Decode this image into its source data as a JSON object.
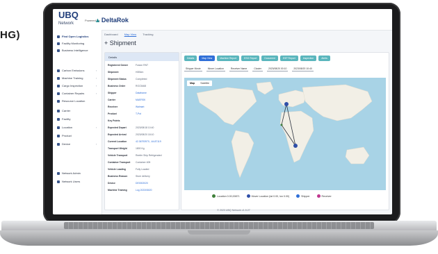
{
  "page_edge_text": "HG)",
  "app": {
    "logo_main": "UBQ",
    "logo_sub": "Network",
    "powered_by": "Powered By",
    "partner": "DeltaRok"
  },
  "sidebar": {
    "items": [
      {
        "label": "Find Open Logistics"
      },
      {
        "label": "Facility Monitoring"
      },
      {
        "label": "Business Intelligence"
      },
      {
        "label": "Carbon Emissions"
      },
      {
        "label": "Machine Training"
      },
      {
        "label": "Cargo Inspection"
      },
      {
        "label": "Container Repairs"
      },
      {
        "label": "Resource Location"
      },
      {
        "label": "Carrier"
      },
      {
        "label": "Facility"
      },
      {
        "label": "Location"
      },
      {
        "label": "Product"
      },
      {
        "label": "Device"
      },
      {
        "label": "Network Admin"
      },
      {
        "label": "Network Users"
      }
    ]
  },
  "breadcrumb": [
    "Dashboard",
    "Map View",
    "Tracking"
  ],
  "page_title": "Shipment",
  "details": {
    "header": "Details",
    "rows": [
      {
        "label": "Registered Owner",
        "value": "Fusion RNT"
      },
      {
        "label": "Shipment",
        "value": "H0B4m"
      },
      {
        "label": "Shipment Status",
        "value": "Completed"
      },
      {
        "label": "Business Order",
        "value": "ROC5468"
      },
      {
        "label": "Shipper",
        "value": "Dataframe"
      },
      {
        "label": "Carrier",
        "value": "MAERSK"
      },
      {
        "label": "Receiver",
        "value": "Walmart"
      },
      {
        "label": "Product",
        "value": "T-Pot"
      },
      {
        "label": "Key Points",
        "value": ""
      },
      {
        "label": "Expected Depart",
        "value": "2023/08/18 10:40"
      },
      {
        "label": "Expected Arrival",
        "value": "2023/08/20 18:10"
      },
      {
        "label": "Current Location",
        "value": "42.36793970, -64.87119"
      },
      {
        "label": "Transport Weight",
        "value": "1800 Kg"
      },
      {
        "label": "Vehicle Transport",
        "value": "Reefer Ship Refrigerated"
      },
      {
        "label": "Container Transport",
        "value": "Container 40ft"
      },
      {
        "label": "Vehicle Loading",
        "value": "Fully Loaded"
      },
      {
        "label": "Business Reason",
        "value": "Store delivery"
      },
      {
        "label": "Device",
        "value": "DE0002020"
      },
      {
        "label": "Machine Training",
        "value": "Log 2023/08/20"
      }
    ]
  },
  "map_panel": {
    "tabs": [
      "Details",
      "Map View",
      "Machine Report",
      "ESG Report",
      "Document",
      "ESP Report",
      "Inspection",
      "Alerts"
    ],
    "active_tab": "Map View",
    "filters": [
      "Shipper Movie",
      "Mover Location",
      "Receiver Name",
      "Cluster",
      "2023/08/20 00:10",
      "2023/08/20 10:40"
    ],
    "map_toggle": [
      "Map",
      "Satellite"
    ],
    "legend": [
      {
        "label": "Location 0.00,00871",
        "color": "#3f7f3a"
      },
      {
        "label": "Mover Location (lat 0.00, lon 0.00)",
        "color": "#2f4fa8"
      },
      {
        "label": "Shipper",
        "color": "#2f6fd8"
      },
      {
        "label": "Receiver",
        "color": "#c0388f"
      }
    ]
  },
  "footer": "© 2023 UBQ Network v1.5.27"
}
